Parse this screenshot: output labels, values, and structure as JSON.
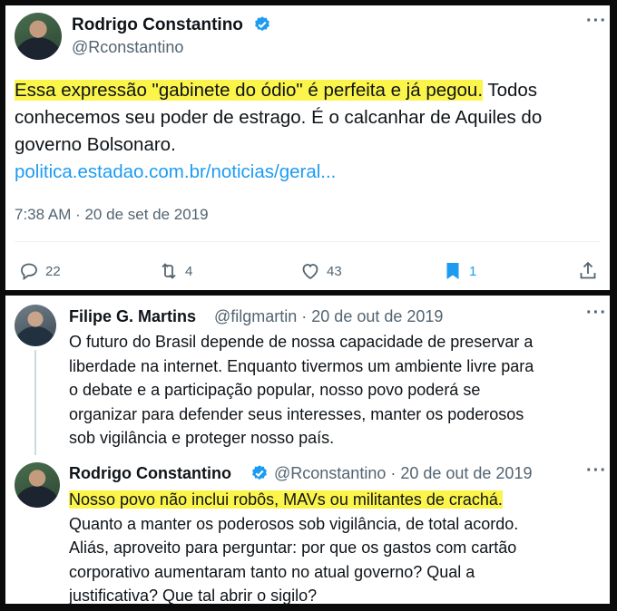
{
  "tweet1": {
    "name": "Rodrigo Constantino",
    "handle": "@Rconstantino",
    "more": "···",
    "text_highlight": "Essa expressão \"gabinete do ódio\" é perfeita e já pegou.",
    "text_rest_line1": " Todos",
    "text_line2": "conhecemos seu poder de estrago. É o calcanhar de Aquiles do",
    "text_line3": "governo Bolsonaro.",
    "link": "politica.estadao.com.br/noticias/geral...",
    "timestamp": "7:38 AM · 20 de set de 2019",
    "replies": "22",
    "retweets": "4",
    "likes": "43",
    "bookmarks": "1",
    "accent": "#1d9bf0",
    "highlight_color": "#fbf44a"
  },
  "tweet2": {
    "name": "Filipe G. Martins",
    "handle": "@filgmartin · 20 de out de 2019",
    "more": "···",
    "lines": [
      "O futuro do Brasil depende de nossa capacidade de preservar a",
      "liberdade na internet. Enquanto tivermos um ambiente livre para",
      "o debate e a participação popular, nosso povo poderá se",
      "organizar para defender seus interesses, manter os poderosos",
      "sob vigilância e proteger nosso país."
    ]
  },
  "tweet3": {
    "name": "Rodrigo Constantino",
    "handle": "@Rconstantino · 20 de out de 2019",
    "more": "···",
    "text_highlight": "Nosso povo não inclui robôs, MAVs ou militantes de crachá.",
    "lines": [
      "Quanto a manter os poderosos sob vigilância, de total acordo.",
      "Aliás, aproveito para perguntar: por que os gastos com cartão",
      "corporativo aumentaram tanto no atual governo? Qual a",
      "justificativa? Que tal abrir o sigilo?"
    ]
  }
}
